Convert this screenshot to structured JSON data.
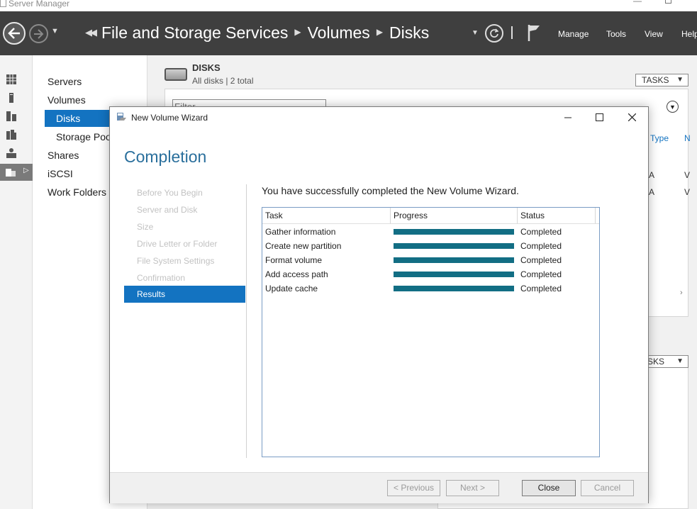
{
  "app": {
    "title": "Server Manager"
  },
  "header": {
    "breadcrumb": [
      "File and Storage Services",
      "Volumes",
      "Disks"
    ],
    "menu": [
      "Manage",
      "Tools",
      "View",
      "Help"
    ]
  },
  "nav": {
    "items": [
      {
        "label": "Servers",
        "level": 0,
        "selected": false
      },
      {
        "label": "Volumes",
        "level": 0,
        "selected": false
      },
      {
        "label": "Disks",
        "level": 1,
        "selected": true
      },
      {
        "label": "Storage Pools",
        "level": 1,
        "selected": false
      },
      {
        "label": "Shares",
        "level": 0,
        "selected": false
      },
      {
        "label": "iSCSI",
        "level": 0,
        "selected": false
      },
      {
        "label": "Work Folders",
        "level": 0,
        "selected": false
      }
    ]
  },
  "main": {
    "disks_title": "DISKS",
    "disks_subtitle": "All disks | 2 total",
    "tasks_label": "TASKS",
    "tasks_label_2": "ASKS",
    "filter_placeholder": "Filter",
    "col_type": "Type",
    "col_n": "N",
    "cells": [
      "A",
      "V",
      "A",
      "V"
    ]
  },
  "wizard": {
    "title": "New Volume Wizard",
    "heading": "Completion",
    "steps": [
      {
        "label": "Before You Begin",
        "active": false
      },
      {
        "label": "Server and Disk",
        "active": false
      },
      {
        "label": "Size",
        "active": false
      },
      {
        "label": "Drive Letter or Folder",
        "active": false
      },
      {
        "label": "File System Settings",
        "active": false
      },
      {
        "label": "Confirmation",
        "active": false
      },
      {
        "label": "Results",
        "active": true
      }
    ],
    "message": "You have successfully completed the New Volume Wizard.",
    "table": {
      "headers": [
        "Task",
        "Progress",
        "Status"
      ],
      "rows": [
        {
          "task": "Gather information",
          "progress": 1.0,
          "status": "Completed"
        },
        {
          "task": "Create new partition",
          "progress": 1.0,
          "status": "Completed"
        },
        {
          "task": "Format volume",
          "progress": 1.0,
          "status": "Completed"
        },
        {
          "task": "Add access path",
          "progress": 1.0,
          "status": "Completed"
        },
        {
          "task": "Update cache",
          "progress": 1.0,
          "status": "Completed"
        }
      ]
    },
    "buttons": {
      "previous": "< Previous",
      "next": "Next >",
      "close": "Close",
      "cancel": "Cancel"
    }
  },
  "colors": {
    "accent": "#1373c1",
    "progress": "#126e84",
    "header_bg": "#3f3f3f",
    "heading": "#2a6f9c"
  }
}
